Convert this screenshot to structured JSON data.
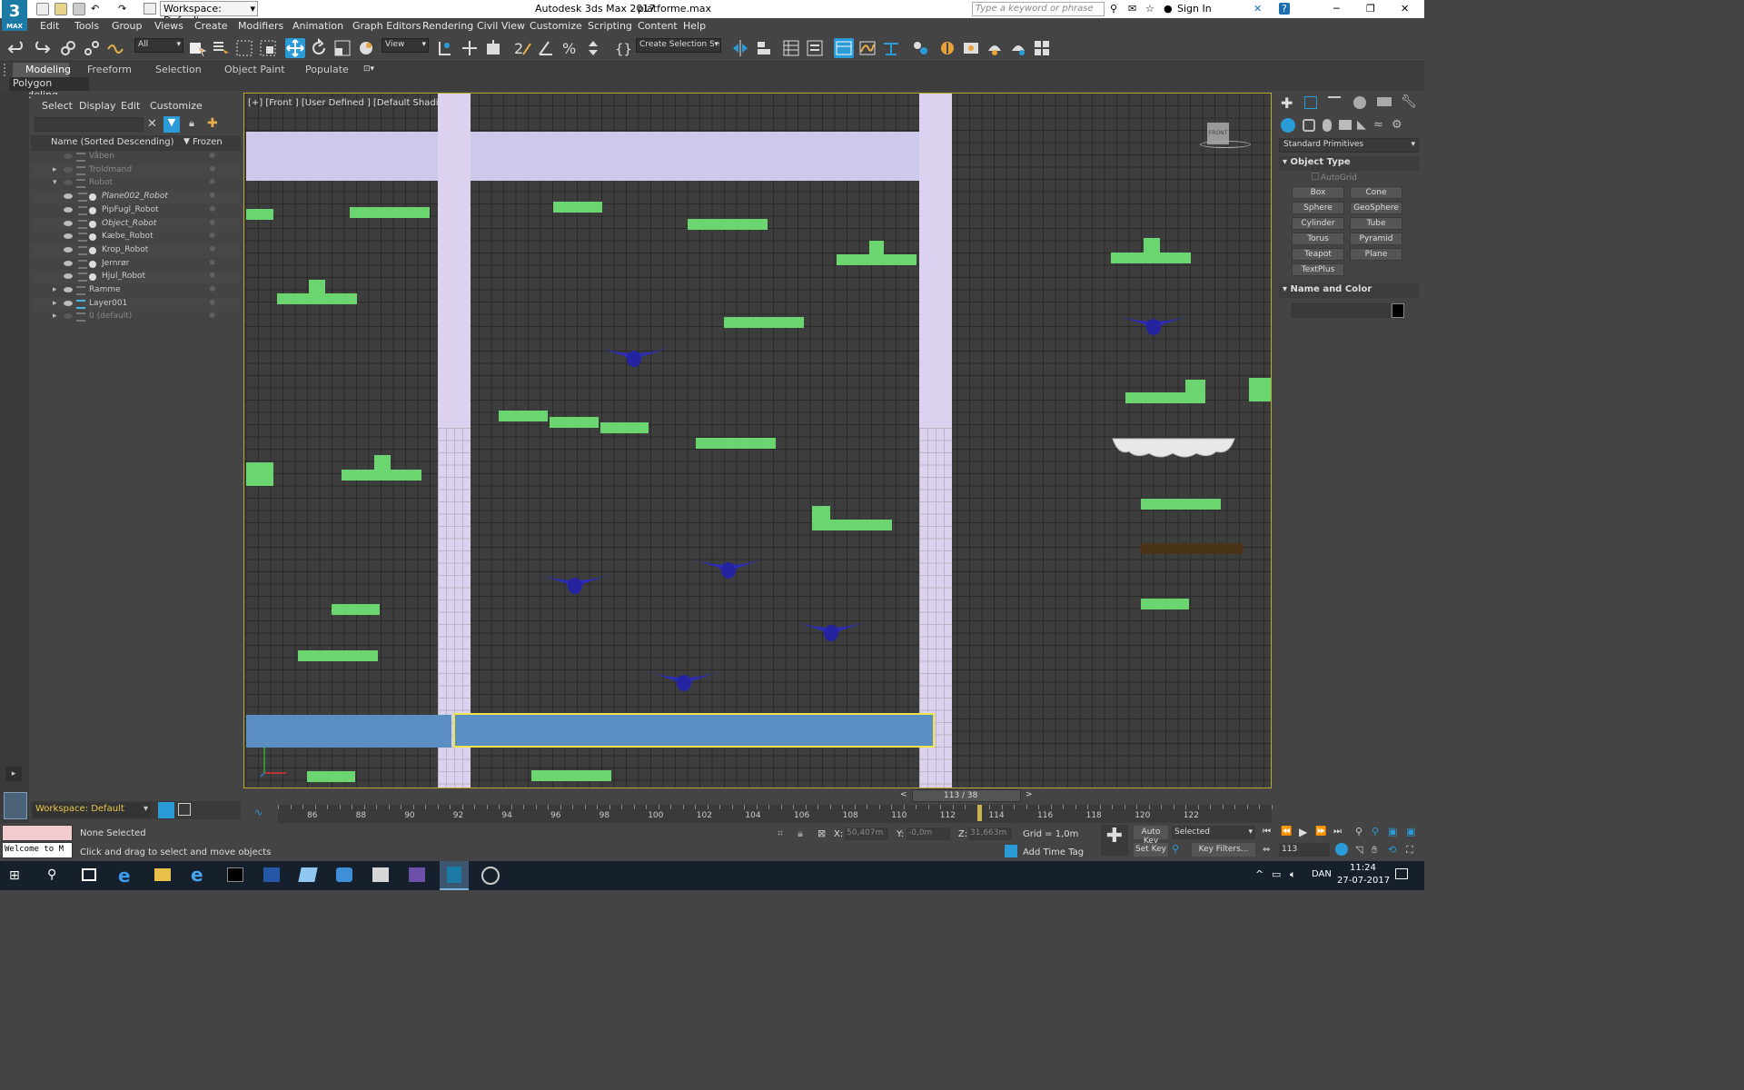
{
  "window": {
    "app_title": "Autodesk 3ds Max 2017",
    "file_name": "platforme.max",
    "workspace_label": "Workspace: Default",
    "search_placeholder": "Type a keyword or phrase",
    "sign_in": "Sign In",
    "logo_text": "MAX"
  },
  "menu": [
    "Edit",
    "Tools",
    "Group",
    "Views",
    "Create",
    "Modifiers",
    "Animation",
    "Graph Editors",
    "Rendering",
    "Civil View",
    "Customize",
    "Scripting",
    "Content",
    "Help"
  ],
  "toolbar": {
    "filter_all": "All",
    "view_label": "View",
    "selection_set": "Create Selection Se"
  },
  "ribbon": {
    "tabs": [
      "Modeling",
      "Freeform",
      "Selection",
      "Object Paint",
      "Populate"
    ],
    "sub_label": "Polygon Modeling"
  },
  "explorer": {
    "menu": [
      "Select",
      "Display",
      "Edit",
      "Customize"
    ],
    "col_name": "Name (Sorted Descending)",
    "col_frozen": "Frozen",
    "rows": [
      {
        "label": "Våben",
        "level": 0,
        "expand": "",
        "italic": false,
        "eye": false
      },
      {
        "label": "Troldmand",
        "level": 0,
        "expand": "▸",
        "italic": false,
        "eye": false
      },
      {
        "label": "Robot",
        "level": 0,
        "expand": "▾",
        "italic": false,
        "eye": false
      },
      {
        "label": "Plane002_Robot",
        "level": 1,
        "expand": "",
        "italic": true,
        "eye": true
      },
      {
        "label": "PipFugl_Robot",
        "level": 1,
        "expand": "",
        "italic": false,
        "eye": true
      },
      {
        "label": "Object_Robot",
        "level": 1,
        "expand": "",
        "italic": true,
        "eye": true
      },
      {
        "label": "Kæbe_Robot",
        "level": 1,
        "expand": "",
        "italic": false,
        "eye": true
      },
      {
        "label": "Krop_Robot",
        "level": 1,
        "expand": "",
        "italic": false,
        "eye": true
      },
      {
        "label": "Jernrør",
        "level": 1,
        "expand": "",
        "italic": false,
        "eye": true
      },
      {
        "label": "Hjul_Robot",
        "level": 1,
        "expand": "",
        "italic": false,
        "eye": true
      },
      {
        "label": "Ramme",
        "level": 0,
        "expand": "▸",
        "italic": false,
        "eye": true
      },
      {
        "label": "Layer001",
        "level": 0,
        "expand": "▸",
        "italic": false,
        "eye": true
      },
      {
        "label": "0 (default)",
        "level": 0,
        "expand": "▸",
        "italic": false,
        "eye": false
      }
    ],
    "workspace_footer": "Workspace: Default"
  },
  "viewport": {
    "label": "[+] [Front ] [User Defined ] [Default Shading ]",
    "viewcube": "FRONT"
  },
  "command_panel": {
    "dropdown": "Standard Primitives",
    "section_object_type": "Object Type",
    "autogrid": "AutoGrid",
    "buttons": [
      "Box",
      "Cone",
      "Sphere",
      "GeoSphere",
      "Cylinder",
      "Tube",
      "Torus",
      "Pyramid",
      "Teapot",
      "Plane",
      "TextPlus"
    ],
    "section_name_color": "Name and Color"
  },
  "timeline": {
    "frame_display": "113 / 38",
    "ticks": [
      "86",
      "88",
      "90",
      "92",
      "94",
      "96",
      "98",
      "100",
      "102",
      "104",
      "106",
      "108",
      "110",
      "112",
      "114",
      "116",
      "118",
      "120",
      "122"
    ]
  },
  "status": {
    "maxscript": "Welcome to M",
    "selection": "None Selected",
    "prompt": "Click and drag to select and move objects",
    "x_label": "X:",
    "x_value": "50,407m",
    "y_label": "Y:",
    "y_value": "-0,0m",
    "z_label": "Z:",
    "z_value": "31,663m",
    "grid": "Grid = 1,0m",
    "add_time_tag": "Add Time Tag",
    "auto_key": "Auto Key",
    "set_key": "Set Key",
    "selected_dropdown": "Selected",
    "key_filters": "Key Filters...",
    "frame_field": "113"
  },
  "taskbar": {
    "language": "DAN",
    "time": "11:24",
    "date": "27-07-2017"
  },
  "colors": {
    "accent": "#2a9bd6",
    "platform_green": "#6bd66f",
    "water_blue": "#5b8fc4",
    "pillar_lavender": "#dcd2ef",
    "selection_yellow": "#ede44a"
  }
}
